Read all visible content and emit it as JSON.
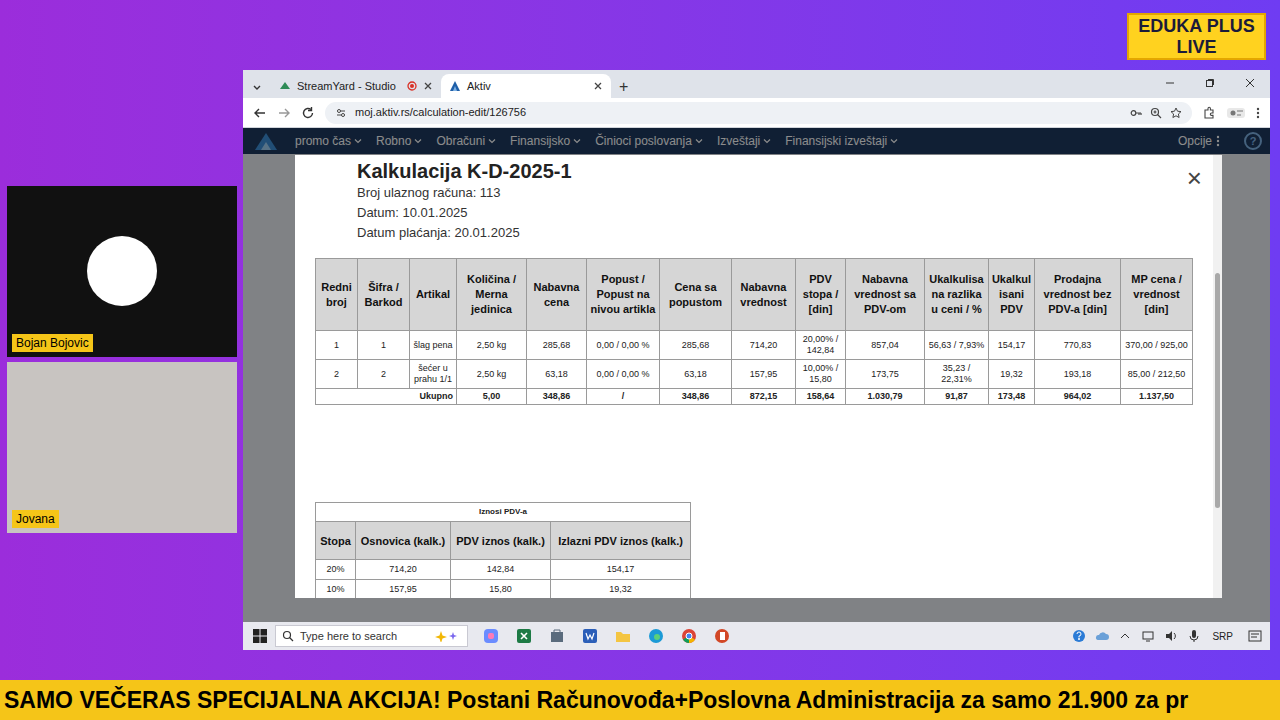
{
  "badge": {
    "line1": "EDUKA PLUS",
    "line2": "LIVE"
  },
  "participants": [
    {
      "name": "Bojan Bojovic"
    },
    {
      "name": "Jovana"
    }
  ],
  "browser": {
    "tabs": [
      {
        "label": "StreamYard - Studio",
        "selected": false
      },
      {
        "label": "Aktiv",
        "selected": true
      }
    ],
    "new_tab": "+",
    "url": "moj.aktiv.rs/calculation-edit/126756"
  },
  "nav": {
    "items": [
      "promo čas",
      "Robno",
      "Obračuni",
      "Finansijsko",
      "Činioci poslovanja",
      "Izveštaji",
      "Finansijski izveštaji"
    ],
    "options": "Opcije",
    "help": "?"
  },
  "modal": {
    "title": "Kalkulacija K-D-2025-1",
    "info": [
      "Broj ulaznog računa: 113",
      "Datum: 10.01.2025",
      "Datum plaćanja: 20.01.2025"
    ],
    "close": "×"
  },
  "table": {
    "columns": [
      "Redni broj",
      "Šifra / Barkod",
      "Artikal",
      "Količina / Merna jedinica",
      "Nabavna cena",
      "Popust / Popust na nivou artikla",
      "Cena sa popustom",
      "Nabavna vrednost",
      "PDV stopa / [din]",
      "Nabavna vrednost sa PDV-om",
      "Ukalkulisana razlika u ceni / %",
      "Ukalkulisani PDV",
      "Prodajna vrednost bez PDV-a [din]",
      "MP cena / vrednost [din]"
    ],
    "rows": [
      [
        "1",
        "1",
        "šlag pena",
        "2,50 kg",
        "285,68",
        "0,00 / 0,00 %",
        "285,68",
        "714,20",
        "20,00% / 142,84",
        "857,04",
        "56,63 / 7,93%",
        "154,17",
        "770,83",
        "370,00 / 925,00"
      ],
      [
        "2",
        "2",
        "šećer u prahu 1/1",
        "2,50 kg",
        "63,18",
        "0,00 / 0,00 %",
        "63,18",
        "157,95",
        "10,00% / 15,80",
        "173,75",
        "35,23 / 22,31%",
        "19,32",
        "193,18",
        "85,00 / 212,50"
      ]
    ],
    "total": {
      "label": "Ukupno",
      "values": [
        "5,00",
        "348,86",
        "/",
        "348,86",
        "872,15",
        "158,64",
        "1.030,79",
        "91,87",
        "173,48",
        "964,02",
        "1.137,50"
      ]
    }
  },
  "vat": {
    "title": "Iznosi PDV-a",
    "columns": [
      "Stopa",
      "Osnovica (kalk.)",
      "PDV iznos (kalk.)",
      "Izlazni PDV iznos (kalk.)"
    ],
    "rows": [
      [
        "20%",
        "714,20",
        "142,84",
        "154,17"
      ],
      [
        "10%",
        "157,95",
        "15,80",
        "19,32"
      ]
    ]
  },
  "taskbar": {
    "search": "Type here to search",
    "lang": "SRP"
  },
  "ticker": "SAMO VEČERAS SPECIJALNA AKCIJA! Postani Računovođa+Poslovna Administracija za samo 21.900 za pr"
}
